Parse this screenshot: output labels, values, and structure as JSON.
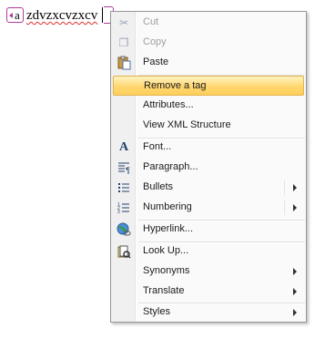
{
  "document": {
    "tag_name": "a",
    "text": "zdvzxcvzxcv"
  },
  "menu": {
    "items": [
      {
        "name": "cut",
        "label": "Cut",
        "icon": "scissors-icon",
        "glyph": "✂",
        "disabled": true
      },
      {
        "name": "copy",
        "label": "Copy",
        "icon": "copy-icon",
        "glyph": "❐",
        "disabled": true
      },
      {
        "name": "paste",
        "label": "Paste",
        "icon": "paste-icon",
        "glyph": "📋",
        "disabled": false
      },
      {
        "name": "remove-tag",
        "label": "Remove a tag",
        "highlighted": true
      },
      {
        "name": "attributes",
        "label": "Attributes..."
      },
      {
        "name": "view-xml-structure",
        "label": "View XML Structure"
      },
      {
        "name": "font",
        "label": "Font...",
        "icon": "font-icon",
        "glyph": "A"
      },
      {
        "name": "paragraph",
        "label": "Paragraph...",
        "icon": "paragraph-icon",
        "glyph": "¶"
      },
      {
        "name": "bullets",
        "label": "Bullets",
        "icon": "bullets-icon",
        "glyph": "☰",
        "submenu": true
      },
      {
        "name": "numbering",
        "label": "Numbering",
        "icon": "numbering-icon",
        "glyph": "≡",
        "submenu": true
      },
      {
        "name": "hyperlink",
        "label": "Hyperlink...",
        "icon": "hyperlink-icon",
        "glyph": "🌐"
      },
      {
        "name": "look-up",
        "label": "Look Up...",
        "icon": "research-icon",
        "glyph": "📖"
      },
      {
        "name": "synonyms",
        "label": "Synonyms",
        "submenu": true
      },
      {
        "name": "translate",
        "label": "Translate",
        "submenu": true
      },
      {
        "name": "styles",
        "label": "Styles",
        "submenu": true
      }
    ]
  }
}
